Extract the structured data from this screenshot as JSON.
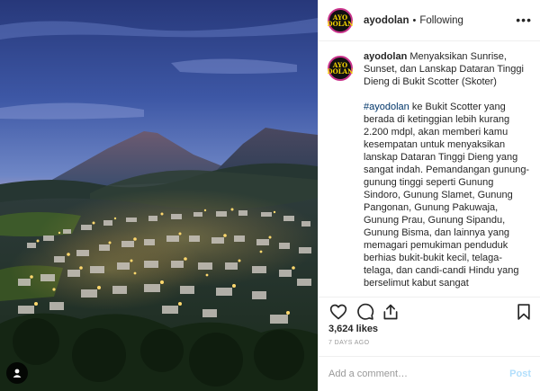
{
  "photo": {
    "alt": "",
    "tag_icon": "user-tag-icon"
  },
  "header": {
    "username": "ayodolan",
    "separator": "•",
    "follow_status": "Following",
    "more_icon": "more-options-icon",
    "avatar_logo": "AYO DOLAN"
  },
  "caption": {
    "username": "ayodolan",
    "title": "Menyaksikan Sunrise, Sunset, dan Lanskap Dataran Tinggi Dieng di Bukit Scotter (Skoter)",
    "hashtag": "#ayodolan",
    "body": "ke Bukit Scotter yang berada di ketinggian lebih kurang 2.200 mdpl, akan memberi kamu kesempatan untuk menyaksikan lanskap Dataran Tinggi Dieng yang sangat indah. Pemandangan gunung-gunung tinggi seperti Gunung Sindoro, Gunung Slamet, Gunung Pangonan, Gunung Pakuwaja, Gunung Prau, Gunung Sipandu, Gunung Bisma, dan lainnya yang memagari pemukiman penduduk berhias bukit-bukit kecil, telaga-telaga, dan candi-candi Hindu yang berselimut kabut sangat"
  },
  "actions": {
    "like_icon": "heart-icon",
    "comment_icon": "comment-icon",
    "share_icon": "share-icon",
    "save_icon": "bookmark-icon"
  },
  "likes": "3,624 likes",
  "posted_ago": "7 DAYS AGO",
  "comment_box": {
    "placeholder": "Add a comment…",
    "post_label": "Post"
  },
  "colors": {
    "hashtag": "#003569",
    "post_disabled": "#b2dffc",
    "avatar_ring": "#c9348c"
  }
}
